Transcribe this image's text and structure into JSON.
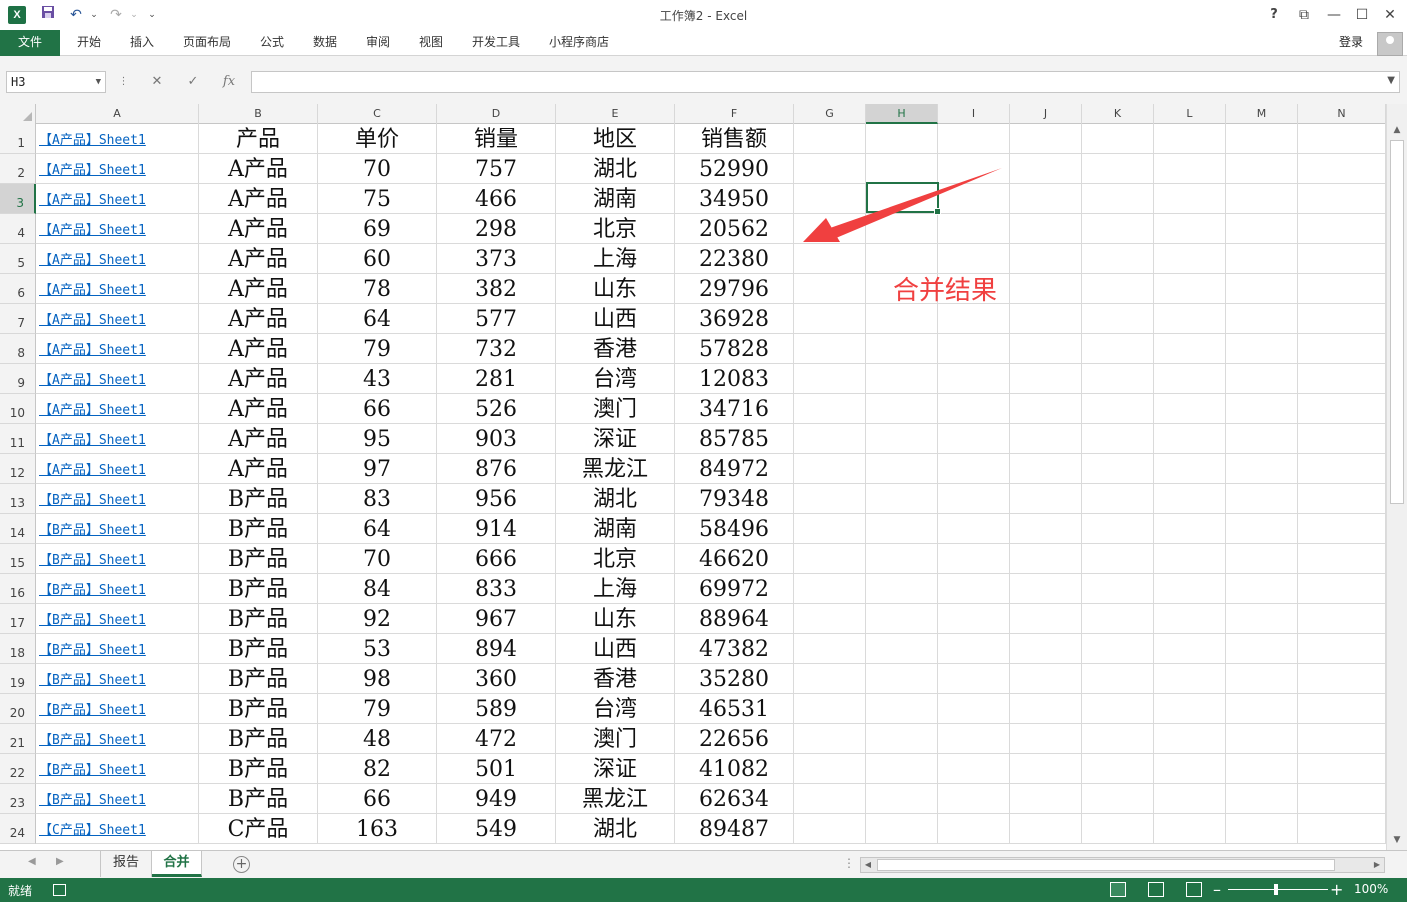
{
  "window": {
    "title": "工作簿2 - Excel",
    "help": "?",
    "restore": "⧉",
    "minimize": "—",
    "maximize": "☐",
    "close": "✕"
  },
  "quick_access": {
    "logo": "X",
    "save": "💾",
    "undo": "↶",
    "redo": "↷",
    "more": "⌄"
  },
  "ribbon": {
    "tabs": [
      "文件",
      "开始",
      "插入",
      "页面布局",
      "公式",
      "数据",
      "审阅",
      "视图",
      "开发工具",
      "小程序商店"
    ],
    "login": "登录"
  },
  "formula_bar": {
    "name_box": "H3",
    "cancel": "✕",
    "enter": "✓",
    "fx": "fx",
    "value": ""
  },
  "columns": [
    "A",
    "B",
    "C",
    "D",
    "E",
    "F",
    "G",
    "H",
    "I",
    "J",
    "K",
    "L",
    "M",
    "N"
  ],
  "selected_column": "H",
  "selected_row": 3,
  "rows": [
    {
      "n": "1",
      "a": "【A产品】Sheet1",
      "b": "产品",
      "c": "单价",
      "d": "销量",
      "e": "地区",
      "f": "销售额"
    },
    {
      "n": "2",
      "a": "【A产品】Sheet1",
      "b": "A产品",
      "c": "70",
      "d": "757",
      "e": "湖北",
      "f": "52990"
    },
    {
      "n": "3",
      "a": "【A产品】Sheet1",
      "b": "A产品",
      "c": "75",
      "d": "466",
      "e": "湖南",
      "f": "34950"
    },
    {
      "n": "4",
      "a": "【A产品】Sheet1",
      "b": "A产品",
      "c": "69",
      "d": "298",
      "e": "北京",
      "f": "20562"
    },
    {
      "n": "5",
      "a": "【A产品】Sheet1",
      "b": "A产品",
      "c": "60",
      "d": "373",
      "e": "上海",
      "f": "22380"
    },
    {
      "n": "6",
      "a": "【A产品】Sheet1",
      "b": "A产品",
      "c": "78",
      "d": "382",
      "e": "山东",
      "f": "29796"
    },
    {
      "n": "7",
      "a": "【A产品】Sheet1",
      "b": "A产品",
      "c": "64",
      "d": "577",
      "e": "山西",
      "f": "36928"
    },
    {
      "n": "8",
      "a": "【A产品】Sheet1",
      "b": "A产品",
      "c": "79",
      "d": "732",
      "e": "香港",
      "f": "57828"
    },
    {
      "n": "9",
      "a": "【A产品】Sheet1",
      "b": "A产品",
      "c": "43",
      "d": "281",
      "e": "台湾",
      "f": "12083"
    },
    {
      "n": "10",
      "a": "【A产品】Sheet1",
      "b": "A产品",
      "c": "66",
      "d": "526",
      "e": "澳门",
      "f": "34716"
    },
    {
      "n": "11",
      "a": "【A产品】Sheet1",
      "b": "A产品",
      "c": "95",
      "d": "903",
      "e": "深证",
      "f": "85785"
    },
    {
      "n": "12",
      "a": "【A产品】Sheet1",
      "b": "A产品",
      "c": "97",
      "d": "876",
      "e": "黑龙江",
      "f": "84972"
    },
    {
      "n": "13",
      "a": "【B产品】Sheet1",
      "b": "B产品",
      "c": "83",
      "d": "956",
      "e": "湖北",
      "f": "79348"
    },
    {
      "n": "14",
      "a": "【B产品】Sheet1",
      "b": "B产品",
      "c": "64",
      "d": "914",
      "e": "湖南",
      "f": "58496"
    },
    {
      "n": "15",
      "a": "【B产品】Sheet1",
      "b": "B产品",
      "c": "70",
      "d": "666",
      "e": "北京",
      "f": "46620"
    },
    {
      "n": "16",
      "a": "【B产品】Sheet1",
      "b": "B产品",
      "c": "84",
      "d": "833",
      "e": "上海",
      "f": "69972"
    },
    {
      "n": "17",
      "a": "【B产品】Sheet1",
      "b": "B产品",
      "c": "92",
      "d": "967",
      "e": "山东",
      "f": "88964"
    },
    {
      "n": "18",
      "a": "【B产品】Sheet1",
      "b": "B产品",
      "c": "53",
      "d": "894",
      "e": "山西",
      "f": "47382"
    },
    {
      "n": "19",
      "a": "【B产品】Sheet1",
      "b": "B产品",
      "c": "98",
      "d": "360",
      "e": "香港",
      "f": "35280"
    },
    {
      "n": "20",
      "a": "【B产品】Sheet1",
      "b": "B产品",
      "c": "79",
      "d": "589",
      "e": "台湾",
      "f": "46531"
    },
    {
      "n": "21",
      "a": "【B产品】Sheet1",
      "b": "B产品",
      "c": "48",
      "d": "472",
      "e": "澳门",
      "f": "22656"
    },
    {
      "n": "22",
      "a": "【B产品】Sheet1",
      "b": "B产品",
      "c": "82",
      "d": "501",
      "e": "深证",
      "f": "41082"
    },
    {
      "n": "23",
      "a": "【B产品】Sheet1",
      "b": "B产品",
      "c": "66",
      "d": "949",
      "e": "黑龙江",
      "f": "62634"
    },
    {
      "n": "24",
      "a": "【C产品】Sheet1",
      "b": "C产品",
      "c": "163",
      "d": "549",
      "e": "湖北",
      "f": "89487"
    }
  ],
  "annotation": {
    "text": "合并结果",
    "color": "#f04040"
  },
  "sheets": {
    "tabs": [
      "报告",
      "合并"
    ],
    "active": "合并",
    "add": "+",
    "nav_prev": "◀",
    "nav_next": "▶",
    "dots": "⋮"
  },
  "scroll": {
    "up": "▲",
    "down": "▼",
    "left": "◀",
    "right": "▶"
  },
  "status": {
    "text": "就绪",
    "zoom": "100%",
    "zoom_minus": "–",
    "zoom_plus": "+"
  },
  "colors": {
    "excel_green": "#217346",
    "link_blue": "#0563c1"
  }
}
